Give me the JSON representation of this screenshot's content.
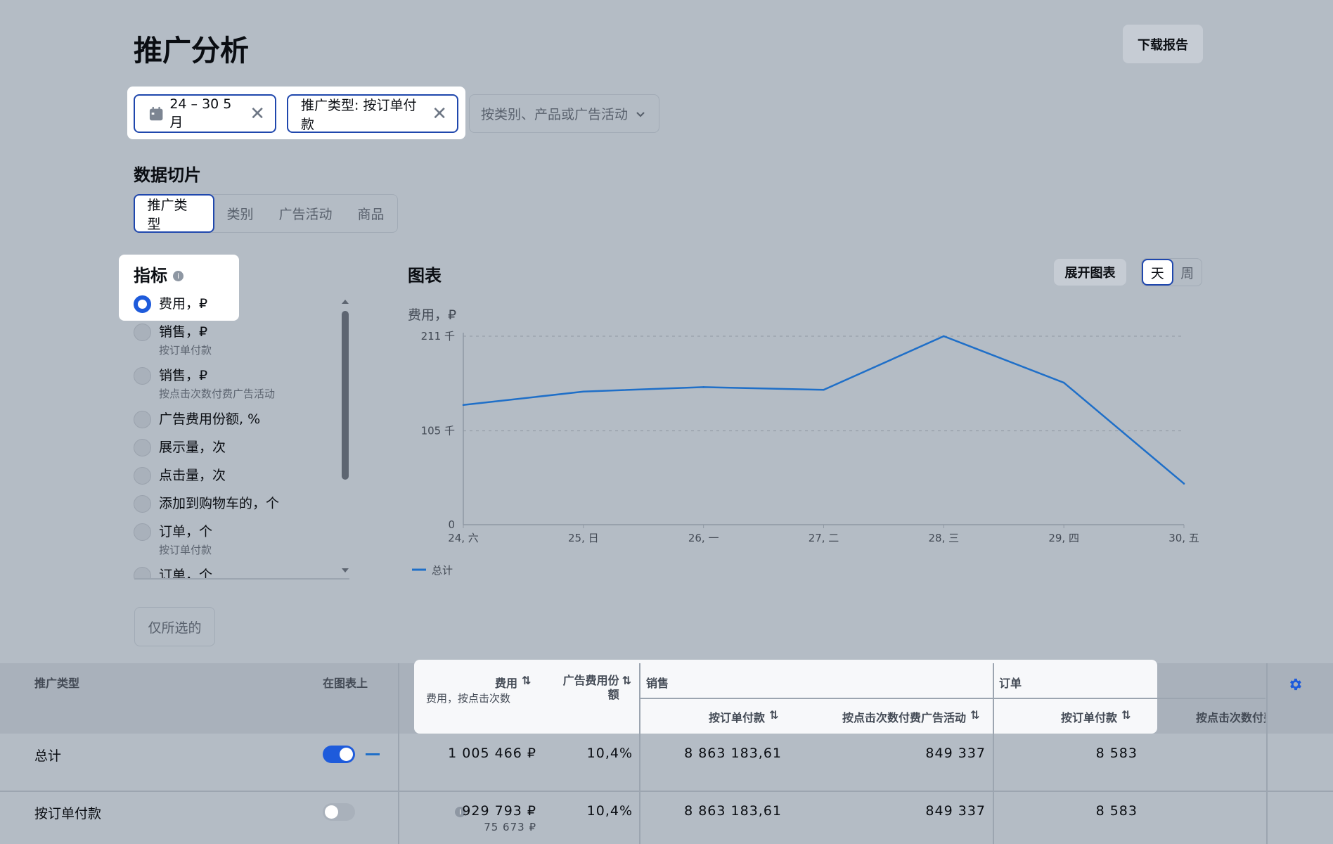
{
  "page": {
    "title": "推广分析",
    "download_label": "下载报告"
  },
  "filters": {
    "date_label": "24 – 30 5月",
    "type_label": "推广类型: 按订单付款",
    "select_placeholder": "按类别、产品或广告活动"
  },
  "slice": {
    "title": "数据切片",
    "tabs": [
      "推广类型",
      "类别",
      "广告活动",
      "商品"
    ],
    "active_tab": 0
  },
  "metrics": {
    "title": "指标",
    "items": [
      {
        "label": "费用，₽",
        "sub": "",
        "selected": true
      },
      {
        "label": "销售，₽",
        "sub": "按订单付款",
        "selected": false
      },
      {
        "label": "销售，₽",
        "sub": "按点击次数付费广告活动",
        "selected": false
      },
      {
        "label": "广告费用份额, %",
        "sub": "",
        "selected": false
      },
      {
        "label": "展示量，次",
        "sub": "",
        "selected": false
      },
      {
        "label": "点击量，次",
        "sub": "",
        "selected": false
      },
      {
        "label": "添加到购物车的，个",
        "sub": "",
        "selected": false
      },
      {
        "label": "订单，个",
        "sub": "按订单付款",
        "selected": false
      },
      {
        "label": "订单，个",
        "sub": "",
        "selected": false
      }
    ]
  },
  "chart_panel": {
    "title": "图表",
    "expand_label": "展开图表",
    "period_options": [
      "天",
      "周"
    ],
    "period_active": 0
  },
  "only_selected_label": "仅所选的",
  "chart_data": {
    "type": "line",
    "ylabel": "费用，₽",
    "ylim": [
      0,
      211000
    ],
    "y_ticks": [
      {
        "value": 0,
        "label": "0"
      },
      {
        "value": 105000,
        "label": "105 千"
      },
      {
        "value": 211000,
        "label": "211 千"
      }
    ],
    "x": [
      "24, 六",
      "25, 日",
      "26, 一",
      "27, 二",
      "28, 三",
      "29, 四",
      "30, 五"
    ],
    "series": [
      {
        "name": "总计",
        "color": "#1f6fc8",
        "values": [
          134000,
          149000,
          154000,
          151000,
          211000,
          159000,
          46000
        ]
      }
    ],
    "grid": "horizontal-dashed",
    "legend": "bottom-left"
  },
  "table": {
    "headers": {
      "type": "推广类型",
      "on_chart": "在图表上",
      "cost": "费用",
      "cost_sub": "费用，按点击次数",
      "share": "广告费用份额",
      "sales_group": "销售",
      "sales_order": "按订单付款",
      "sales_click": "按点击次数付费广告活动",
      "orders_group": "订单",
      "orders_order": "按订单付款",
      "orders_click": "按点击次数付费"
    },
    "rows": [
      {
        "name": "总计",
        "toggle": true,
        "cost": "1 005 466 ₽",
        "cost_sub": "",
        "share": "10,4%",
        "sales_order": "8 863 183,61",
        "sales_click": "849 337",
        "orders_order": "8 583"
      },
      {
        "name": "按订单付款",
        "toggle": false,
        "cost": "929 793 ₽",
        "cost_sub": "75 673 ₽",
        "share": "10,4%",
        "sales_order": "8 863 183,61",
        "sales_click": "849 337",
        "orders_order": "8 583"
      }
    ]
  },
  "colors": {
    "accent": "#1e5bdb",
    "line": "#1f6fc8",
    "focus": "#1f47ad"
  }
}
